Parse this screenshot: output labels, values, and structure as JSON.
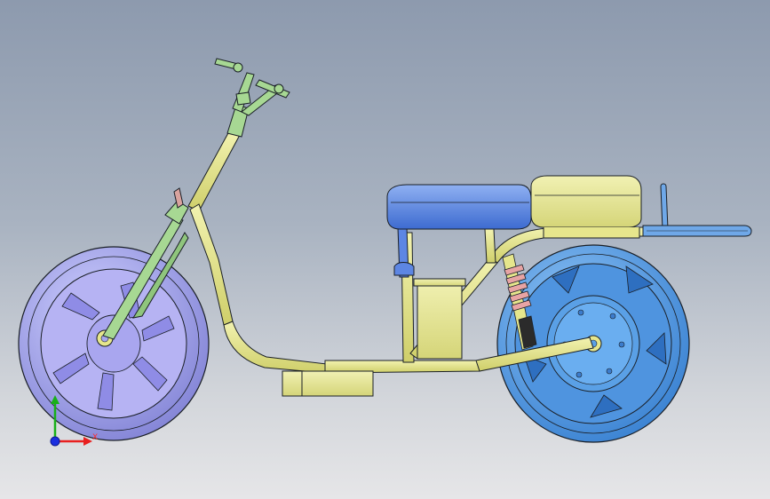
{
  "viewport": {
    "background_top": "#8d9aae",
    "background_bottom": "#e6e6e8"
  },
  "model": {
    "part_colors": {
      "frame": "#e6e68c",
      "front_wheel_tire": "#a7a8ee",
      "front_wheel_rim": "#b6b3f3",
      "rear_wheel_tire": "#5aa0e6",
      "rear_wheel_hub": "#4f94df",
      "seat": "#5d86e3",
      "cargo_box": "#e6e68c",
      "fork": "#a7d893",
      "handlebar": "#a7d893",
      "shock_spring": "#e8a4a4",
      "footrest_bar": "#6fa8e8",
      "outline": "#1a1f26"
    }
  },
  "triad": {
    "x_label": "X",
    "icons": [
      "triad-x-axis-icon",
      "triad-y-axis-icon",
      "triad-z-axis-icon"
    ],
    "x_color": "#e82020",
    "y_color": "#18b018",
    "z_color": "#1a2fe0"
  }
}
